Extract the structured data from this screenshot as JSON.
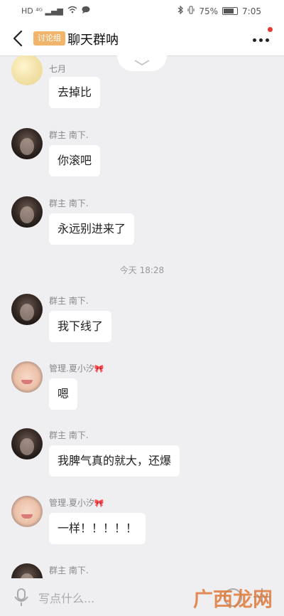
{
  "status_bar": {
    "network": "HD ⁴ᴳ ▂▄▆",
    "battery": "75%",
    "time": "7:05"
  },
  "header": {
    "tag": "讨论组",
    "title": "聊天群呐"
  },
  "messages": [
    {
      "name": "七月",
      "text": "去掉比",
      "avatar": "first"
    },
    {
      "name": "群主  南下.",
      "text": "你滚吧",
      "avatar": "dark"
    },
    {
      "name": "群主  南下.",
      "text": "永远别进来了",
      "avatar": "dark"
    },
    {
      "name": "群主  南下.",
      "text": "我下线了",
      "avatar": "dark"
    },
    {
      "name": "管理.夏小汐",
      "text": "嗯",
      "avatar": "baby"
    },
    {
      "name": "群主  南下.",
      "text": "我脾气真的就大，还爆",
      "avatar": "dark"
    },
    {
      "name": "管理.夏小汐",
      "text": "一样！！！！！",
      "avatar": "baby"
    },
    {
      "name": "群主  南下.",
      "text": "",
      "avatar": "dark"
    }
  ],
  "time_separator": "今天 18:28",
  "bow_emoji": "🎀",
  "input": {
    "placeholder": "写点什么..."
  },
  "watermark": "广西龙网",
  "icons": [
    "back-arrow-icon",
    "more-icon",
    "chevron-down-icon",
    "mic-icon",
    "emoji-icon",
    "plus-icon"
  ],
  "colors": {
    "tag": "#f0b46a",
    "badge": "#e53935",
    "background": "#efeff2"
  }
}
